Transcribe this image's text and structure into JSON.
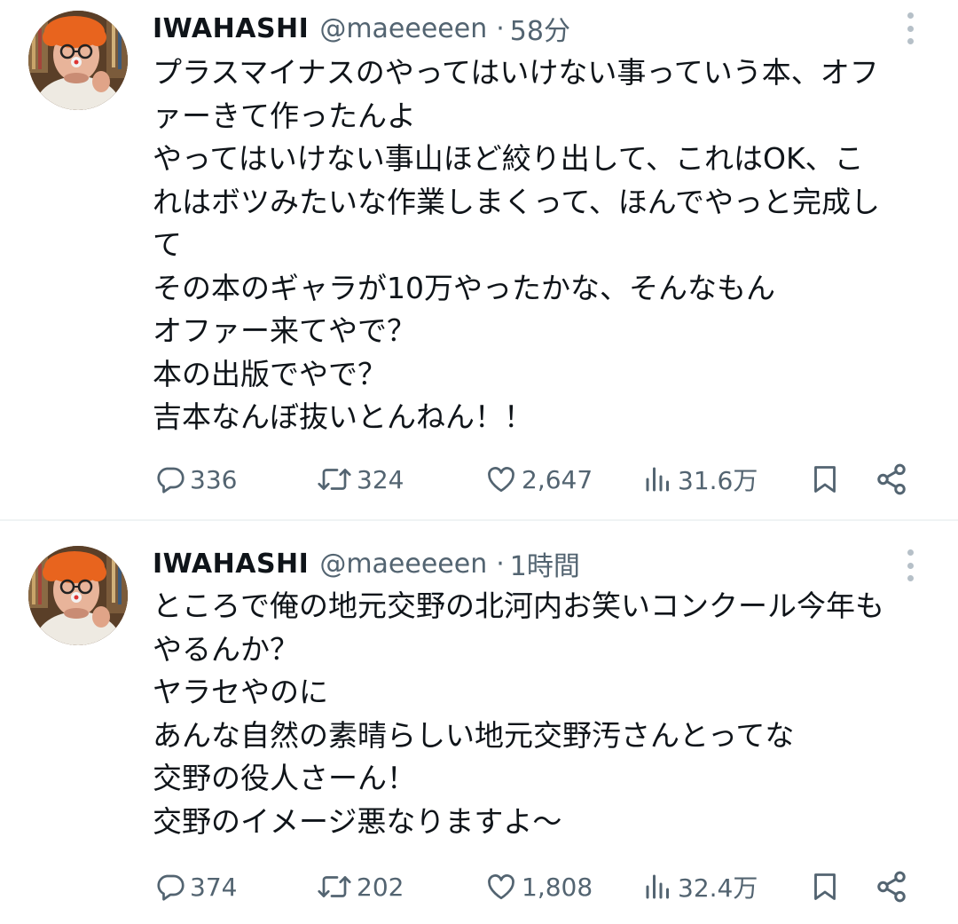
{
  "tweets": [
    {
      "author_name": "IWAHASHI",
      "handle": "@maeeeeen",
      "separator": "·",
      "time": "58分",
      "lines": [
        "プラスマイナスのやってはいけない事っていう本、オフ",
        "ァーきて作ったんよ",
        "やってはいけない事山ほど絞り出して、これはOK、こ",
        "れはボツみたいな作業しまくって、ほんでやっと完成し",
        "て",
        "その本のギャラが10万やったかな、そんなもん",
        "オファー来てやで？",
        "本の出版でやで？",
        "吉本なんぼ抜いとんねん！！"
      ],
      "replies": "336",
      "retweets": "324",
      "likes": "2,647",
      "views": "31.6万"
    },
    {
      "author_name": "IWAHASHI",
      "handle": "@maeeeeen",
      "separator": "·",
      "time": "1時間",
      "lines": [
        "ところで俺の地元交野の北河内お笑いコンクール今年も",
        "やるんか？",
        "ヤラセやのに",
        "あんな自然の素晴らしい地元交野汚さんとってな",
        "交野の役人さーん！",
        "交野のイメージ悪なりますよ〜"
      ],
      "replies": "374",
      "retweets": "202",
      "likes": "1,808",
      "views": "32.4万"
    }
  ],
  "icons": {
    "reply": "speech-bubble-icon",
    "retweet": "retweet-arrows-icon",
    "like": "heart-icon",
    "views": "bar-chart-icon",
    "bookmark": "bookmark-icon",
    "share": "share-icon",
    "more": "vertical-dots-icon"
  },
  "colors": {
    "text": "#0f1419",
    "secondary": "#536471",
    "divider": "#eff3f4",
    "more_dots": "#b6c0c8",
    "avatar_wig": "#e8641e"
  }
}
